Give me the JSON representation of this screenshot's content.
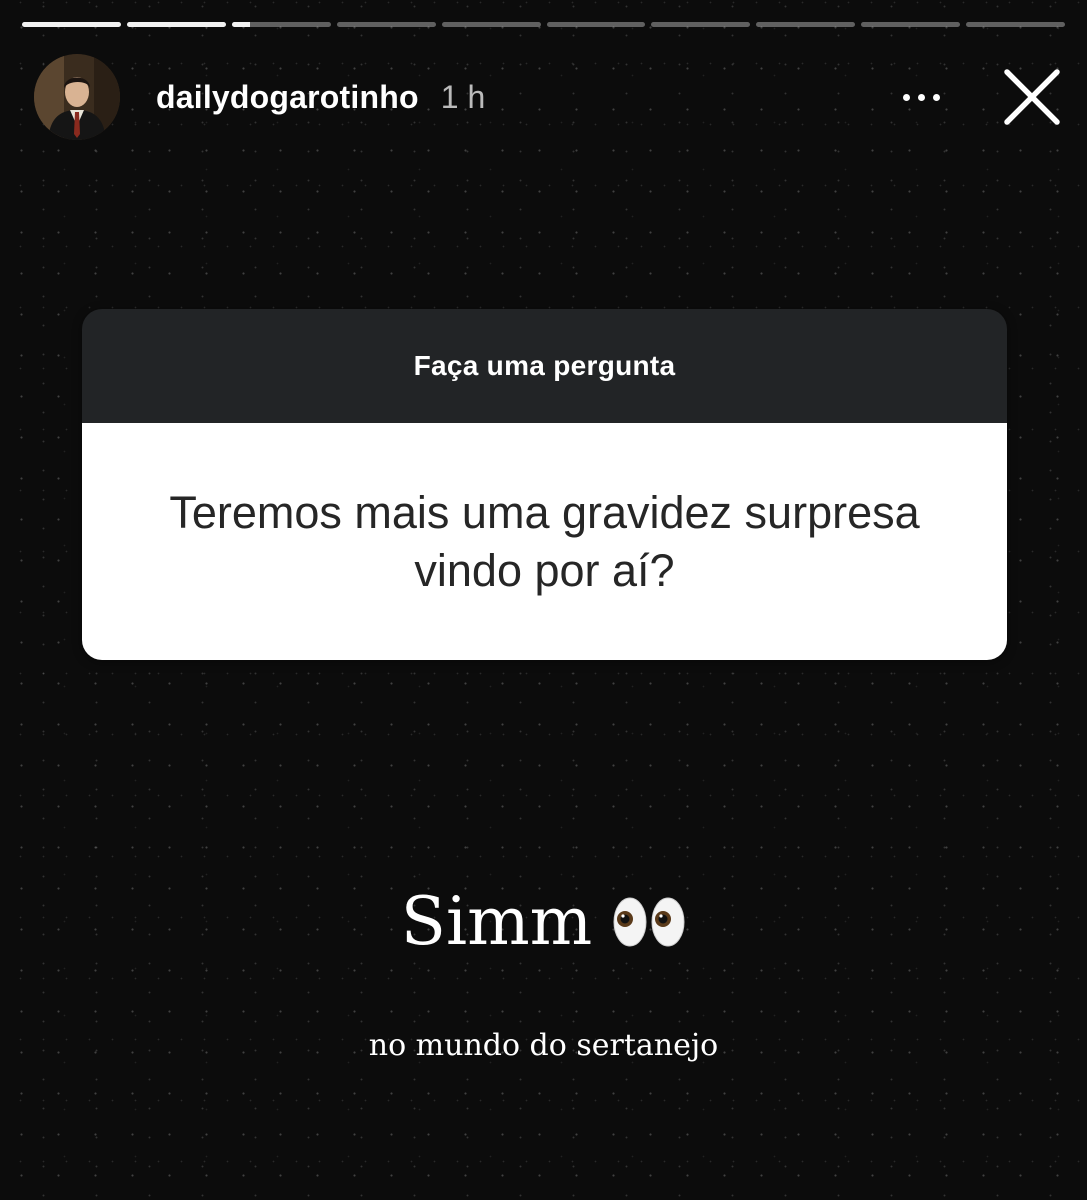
{
  "story": {
    "progress_segments": [
      1,
      1,
      0.18,
      0,
      0,
      0,
      0,
      0,
      0,
      0
    ],
    "colors": {
      "background": "#0c0c0c",
      "progress_active": "#f2f2f2",
      "progress_inactive": "rgba(255,255,255,0.35)",
      "question_header_bg": "#222426",
      "question_body_bg": "#ffffff"
    }
  },
  "header": {
    "username": "dailydogarotinho",
    "timestamp": "1 h",
    "avatar_icon": "profile-photo",
    "more_icon": "ellipsis-horizontal-icon",
    "close_icon": "close-x-icon"
  },
  "question_sticker": {
    "header": "Faça uma pergunta",
    "question": "Teremos mais uma gravidez surpresa vindo por aí?"
  },
  "reply": {
    "text": "Simm",
    "emoji_icon": "eyes-emoji"
  },
  "caption": {
    "text": "no mundo do sertanejo"
  }
}
